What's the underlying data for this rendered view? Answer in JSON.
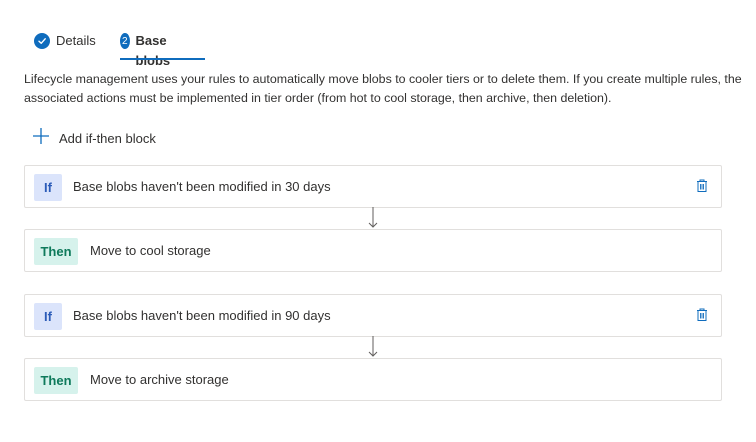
{
  "tabs": [
    {
      "label": "Details",
      "icon": "checkmark-icon",
      "state": "completed"
    },
    {
      "label": "Base blobs",
      "step": "2",
      "state": "active"
    }
  ],
  "description": "Lifecycle management uses your rules to automatically move blobs to cooler tiers or to delete them. If you create multiple rules, the associated actions must be implemented in tier order (from hot to cool storage, then archive, then deletion).",
  "add_block": {
    "label": "Add if-then block",
    "icon": "plus-icon"
  },
  "rules": [
    {
      "if_label": "If",
      "if_text": "Base blobs haven't been modified in 30 days",
      "then_label": "Then",
      "then_text": "Move to cool storage"
    },
    {
      "if_label": "If",
      "if_text": "Base blobs haven't been modified in 90 days",
      "then_label": "Then",
      "then_text": "Move to archive storage"
    }
  ],
  "colors": {
    "accent": "#0f6cbd",
    "if_badge_bg": "#dbe4fb",
    "if_badge_text": "#2b5bb8",
    "then_badge_bg": "#d6f2ec",
    "then_badge_text": "#0e7a5b"
  }
}
